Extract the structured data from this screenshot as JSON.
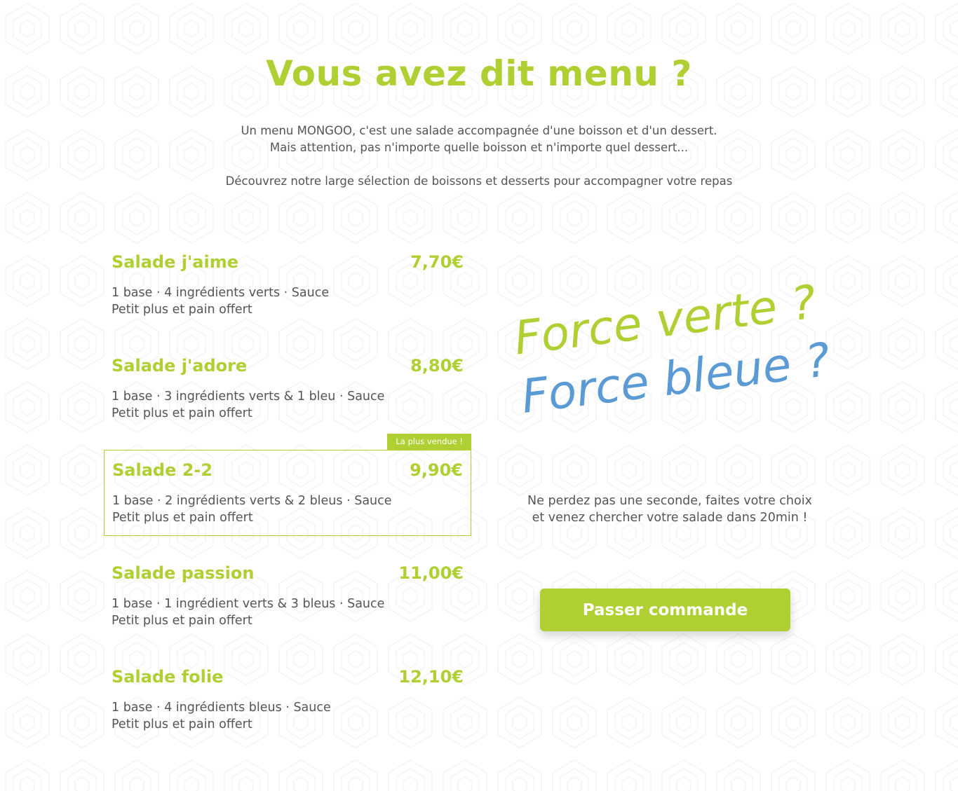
{
  "header": {
    "title": "Vous avez dit menu ?",
    "intro_line_1": "Un menu MONGOO, c'est une salade accompagnée d'une boisson et d'un dessert.",
    "intro_line_2": "Mais attention, pas n'importe quelle boisson et n'importe quel dessert...",
    "intro_line_3": "Découvrez notre large sélection de boissons et desserts pour accompagner votre repas"
  },
  "menu": {
    "items": [
      {
        "name": "Salade j'aime",
        "price": "7,70€",
        "desc_1": "1 base · 4 ingrédients verts · Sauce",
        "desc_2": "Petit plus et pain offert"
      },
      {
        "name": "Salade j'adore",
        "price": "8,80€",
        "desc_1": "1 base · 3 ingrédients verts & 1 bleu · Sauce",
        "desc_2": "Petit plus et pain offert"
      },
      {
        "name": "Salade 2-2",
        "price": "9,90€",
        "desc_1": "1 base · 2 ingrédients verts & 2 bleus · Sauce",
        "desc_2": "Petit plus et pain offert",
        "badge": "La plus vendue !"
      },
      {
        "name": "Salade passion",
        "price": "11,00€",
        "desc_1": "1 base · 1 ingrédient verts & 3 bleus · Sauce",
        "desc_2": "Petit plus et pain offert"
      },
      {
        "name": "Salade folie",
        "price": "12,10€",
        "desc_1": "1 base · 4 ingrédients bleus · Sauce",
        "desc_2": "Petit plus et pain offert"
      }
    ]
  },
  "promo": {
    "line_green": "Force verte ?",
    "line_blue": "Force bleue ?",
    "cta_line_1": "Ne perdez pas une seconde, faites votre choix",
    "cta_line_2": "et venez chercher votre salade dans 20min !",
    "button_label": "Passer commande"
  },
  "colors": {
    "accent_green": "#b0cf32",
    "accent_blue": "#5b9bd5",
    "text_gray": "#555555"
  }
}
